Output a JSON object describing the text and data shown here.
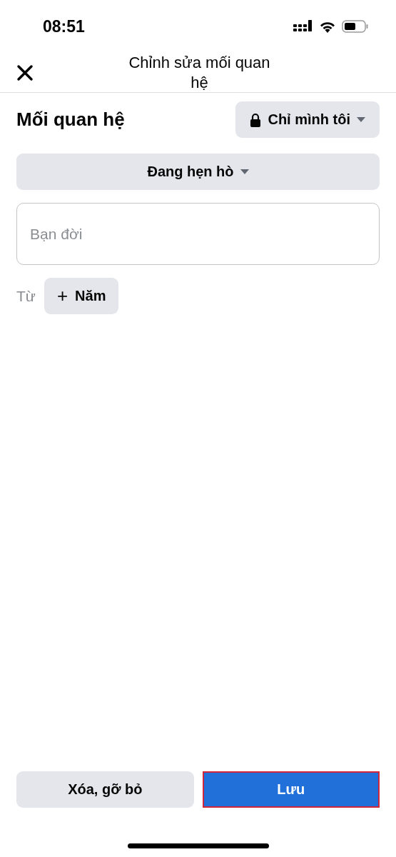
{
  "status_bar": {
    "time": "08:51"
  },
  "header": {
    "title": "Chỉnh sửa mối quan hệ"
  },
  "section": {
    "title": "Mối quan hệ",
    "privacy": {
      "label": "Chỉ mình tôi"
    }
  },
  "status_dropdown": {
    "value": "Đang hẹn hò"
  },
  "partner_field": {
    "placeholder": "Bạn đời"
  },
  "from_row": {
    "label": "Từ",
    "button": {
      "icon": "+",
      "label": "Năm"
    }
  },
  "actions": [
    {
      "label": "Xóa, gỡ bỏ",
      "kind": "secondary",
      "highlighted": false
    },
    {
      "label": "Lưu",
      "kind": "primary",
      "highlighted": true
    }
  ]
}
